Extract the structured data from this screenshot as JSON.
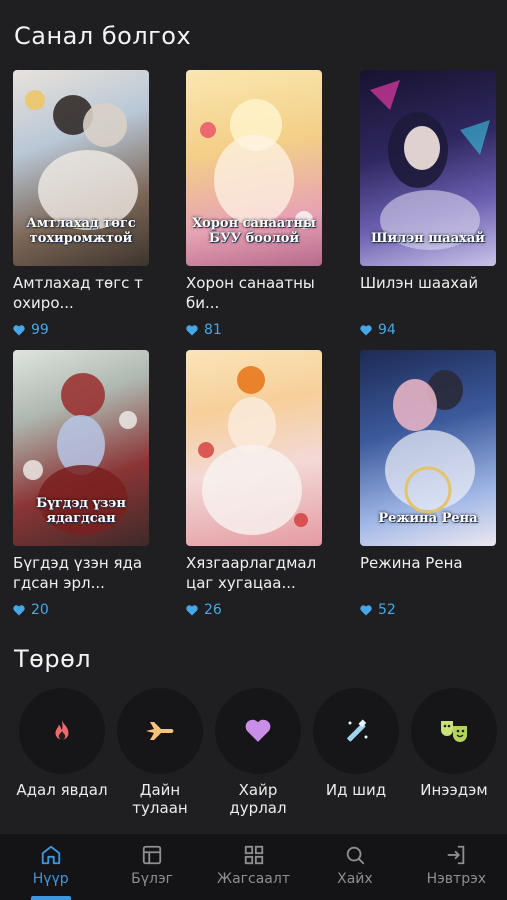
{
  "recommended": {
    "title": "Санал болгох",
    "items": [
      {
        "title": "Амтлахад төгс тохиро...",
        "likes": "99",
        "cover_text": "Амтлахад төгс тохиромжтой",
        "bg1": "#c9d3dc",
        "bg2": "#6e5a4a"
      },
      {
        "title": "Хорон санаатны би...",
        "likes": "81",
        "cover_text": "Хорон санаатны БУУ боолой",
        "bg1": "#f3d48a",
        "bg2": "#d8899e"
      },
      {
        "title": "Шилэн шаахай",
        "likes": "94",
        "cover_text": "Шилэн шаахай",
        "bg1": "#2b2552",
        "bg2": "#7a6fb8"
      },
      {
        "title": "Бүгдэд үзэн ядагдсан эрл...",
        "likes": "20",
        "cover_text": "Бүгдэд үзэн ядагдсан",
        "bg1": "#8e3a3a",
        "bg2": "#c7cbc9"
      },
      {
        "title": "Хязгаарлагдмал цаг хугацаа...",
        "likes": "26",
        "cover_text": "",
        "bg1": "#f6d6a0",
        "bg2": "#e9b0b8"
      },
      {
        "title": "Режина Рена",
        "likes": "52",
        "cover_text": "Режина Рена",
        "bg1": "#2d3e78",
        "bg2": "#9fb3e3"
      }
    ]
  },
  "genres": {
    "title": "Төрөл",
    "items": [
      {
        "label": "Адал явдал",
        "icon": "fire-icon",
        "color": "#ec6a6a"
      },
      {
        "label": "Дайн тулаан",
        "icon": "jet-icon",
        "color": "#f5c37a"
      },
      {
        "label": "Хайр дурлал",
        "icon": "heart-icon",
        "color": "#c98ee8"
      },
      {
        "label": "Ид шид",
        "icon": "magic-wand-icon",
        "color": "#9fd3f0"
      },
      {
        "label": "Инээдэм",
        "icon": "theater-masks-icon",
        "color": "#c9e27a"
      }
    ]
  },
  "nav": {
    "items": [
      {
        "label": "Нүүр",
        "icon": "home-icon",
        "active": true
      },
      {
        "label": "Бүлэг",
        "icon": "layout-icon",
        "active": false
      },
      {
        "label": "Жагсаалт",
        "icon": "grid-icon",
        "active": false
      },
      {
        "label": "Хайх",
        "icon": "search-icon",
        "active": false
      },
      {
        "label": "Нэвтрэх",
        "icon": "login-icon",
        "active": false
      }
    ]
  },
  "colors": {
    "accent": "#3d98e0",
    "like": "#46a7e8",
    "background": "#1f1f21"
  }
}
